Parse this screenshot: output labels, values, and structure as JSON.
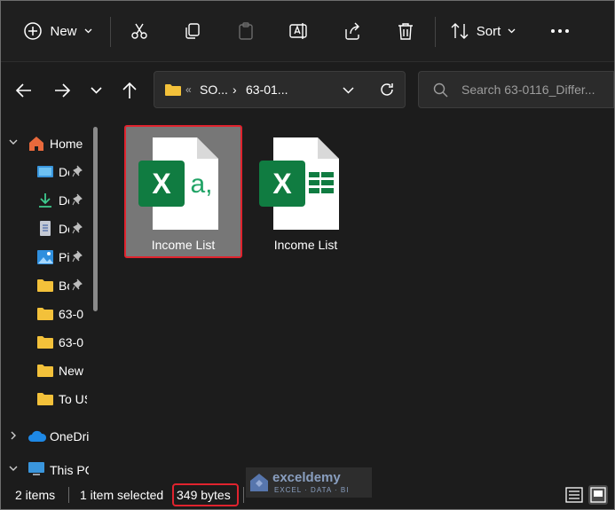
{
  "toolbar": {
    "new_label": "New",
    "sort_label": "Sort"
  },
  "address": {
    "crumb1": "SO...",
    "crumb2": "63-01...",
    "search_placeholder": "Search 63-0116_Differ..."
  },
  "sidebar": {
    "items": [
      {
        "label": "Home",
        "icon": "home-icon"
      },
      {
        "label": "Desktop",
        "icon": "desktop-icon",
        "pinned": true
      },
      {
        "label": "Downloads",
        "icon": "download-icon",
        "pinned": true
      },
      {
        "label": "Documents",
        "icon": "document-icon",
        "pinned": true
      },
      {
        "label": "Pictures",
        "icon": "picture-icon",
        "pinned": true
      },
      {
        "label": "Books",
        "icon": "folder-icon",
        "pinned": true
      },
      {
        "label": "63-0",
        "icon": "folder-icon"
      },
      {
        "label": "63-0",
        "icon": "folder-icon"
      },
      {
        "label": "New",
        "icon": "folder-icon"
      },
      {
        "label": "To US",
        "icon": "folder-icon"
      },
      {
        "label": "OneDrive",
        "icon": "cloud-icon"
      },
      {
        "label": "This PC",
        "icon": "pc-icon"
      }
    ]
  },
  "files": [
    {
      "name": "Income List",
      "type": "csv",
      "selected": true
    },
    {
      "name": "Income List",
      "type": "xlsx",
      "selected": false
    }
  ],
  "status": {
    "items": "2 items",
    "selected": "1 item selected",
    "size": "349 bytes"
  },
  "watermark": {
    "name": "exceldemy",
    "tagline": "EXCEL · DATA · BI"
  },
  "colors": {
    "accent_highlight": "#e0232e",
    "excel_green": "#107c41",
    "folder": "#f3c13a"
  }
}
